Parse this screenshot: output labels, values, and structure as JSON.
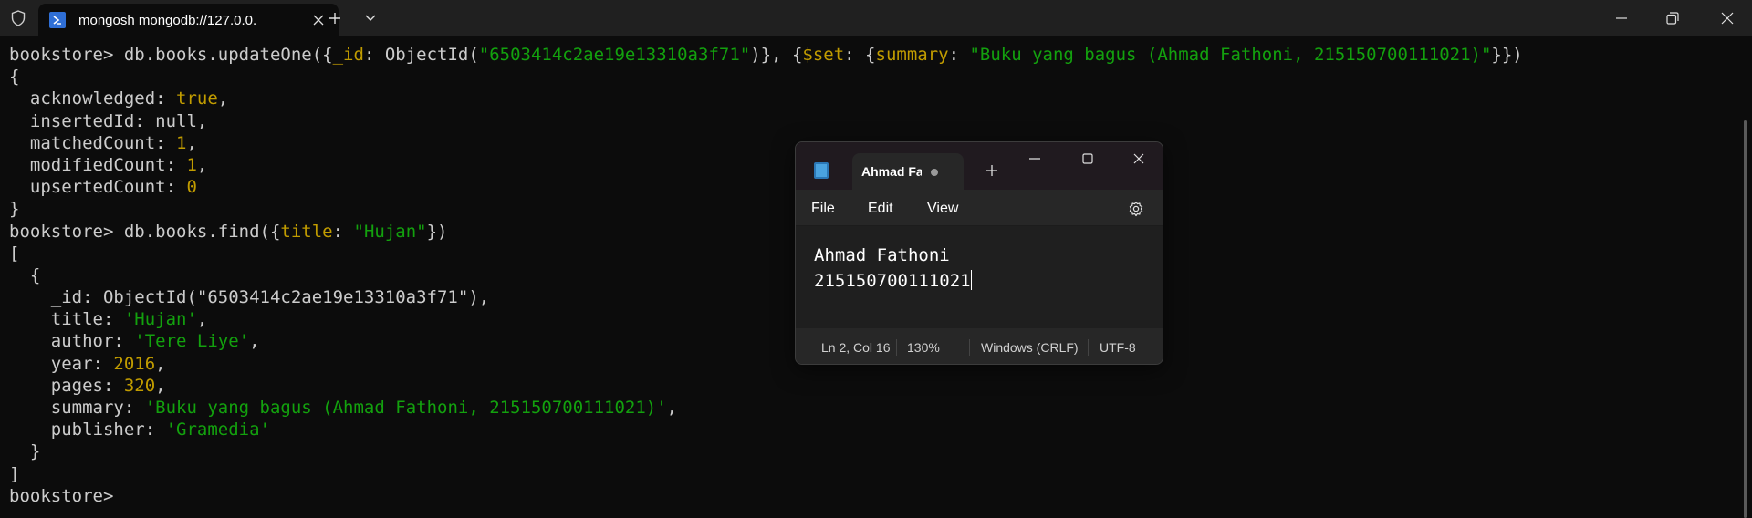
{
  "terminal": {
    "tab_title": "mongosh mongodb://127.0.0.",
    "lines": [
      [
        {
          "t": "bookstore> db.books.updateOne({"
        },
        {
          "t": "_id",
          "c": "c-key"
        },
        {
          "t": ": ObjectId("
        },
        {
          "t": "\"6503414c2ae19e13310a3f71\"",
          "c": "c-str"
        },
        {
          "t": ")}, {"
        },
        {
          "t": "$set",
          "c": "c-key"
        },
        {
          "t": ": {"
        },
        {
          "t": "summary",
          "c": "c-key"
        },
        {
          "t": ": "
        },
        {
          "t": "\"Buku yang bagus (Ahmad Fathoni, 215150700111021)\"",
          "c": "c-str"
        },
        {
          "t": "}})"
        }
      ],
      [
        {
          "t": "{"
        }
      ],
      [
        {
          "t": "  acknowledged: "
        },
        {
          "t": "true",
          "c": "c-bool"
        },
        {
          "t": ","
        }
      ],
      [
        {
          "t": "  insertedId: "
        },
        {
          "t": "null",
          "c": "c-null"
        },
        {
          "t": ","
        }
      ],
      [
        {
          "t": "  matchedCount: "
        },
        {
          "t": "1",
          "c": "c-num"
        },
        {
          "t": ","
        }
      ],
      [
        {
          "t": "  modifiedCount: "
        },
        {
          "t": "1",
          "c": "c-num"
        },
        {
          "t": ","
        }
      ],
      [
        {
          "t": "  upsertedCount: "
        },
        {
          "t": "0",
          "c": "c-num"
        }
      ],
      [
        {
          "t": "}"
        }
      ],
      [
        {
          "t": "bookstore> db.books.find({"
        },
        {
          "t": "title",
          "c": "c-key"
        },
        {
          "t": ": "
        },
        {
          "t": "\"Hujan\"",
          "c": "c-str"
        },
        {
          "t": "})"
        }
      ],
      [
        {
          "t": "["
        }
      ],
      [
        {
          "t": "  {"
        }
      ],
      [
        {
          "t": "    _id: ObjectId(\"6503414c2ae19e13310a3f71\"),"
        }
      ],
      [
        {
          "t": "    title: "
        },
        {
          "t": "'Hujan'",
          "c": "c-str"
        },
        {
          "t": ","
        }
      ],
      [
        {
          "t": "    author: "
        },
        {
          "t": "'Tere Liye'",
          "c": "c-str"
        },
        {
          "t": ","
        }
      ],
      [
        {
          "t": "    year: "
        },
        {
          "t": "2016",
          "c": "c-num"
        },
        {
          "t": ","
        }
      ],
      [
        {
          "t": "    pages: "
        },
        {
          "t": "320",
          "c": "c-num"
        },
        {
          "t": ","
        }
      ],
      [
        {
          "t": "    summary: "
        },
        {
          "t": "'Buku yang bagus (Ahmad Fathoni, 215150700111021)'",
          "c": "c-str"
        },
        {
          "t": ","
        }
      ],
      [
        {
          "t": "    publisher: "
        },
        {
          "t": "'Gramedia'",
          "c": "c-str"
        }
      ],
      [
        {
          "t": "  }"
        }
      ],
      [
        {
          "t": "]"
        }
      ],
      [
        {
          "t": "bookstore> "
        }
      ]
    ]
  },
  "notepad": {
    "tab_label": "Ahmad Fa",
    "menu": {
      "file": "File",
      "edit": "Edit",
      "view": "View"
    },
    "editor": {
      "line1": "Ahmad Fathoni",
      "line2": "215150700111021"
    },
    "status": {
      "position": "Ln 2, Col 16",
      "zoom": "130%",
      "line_ending": "Windows (CRLF)",
      "encoding": "UTF-8"
    }
  },
  "colors": {
    "terminal_bg": "#0c0c0c",
    "key": "#c19c00",
    "string": "#13a10e",
    "tab_icon": "#2f6fd6"
  }
}
